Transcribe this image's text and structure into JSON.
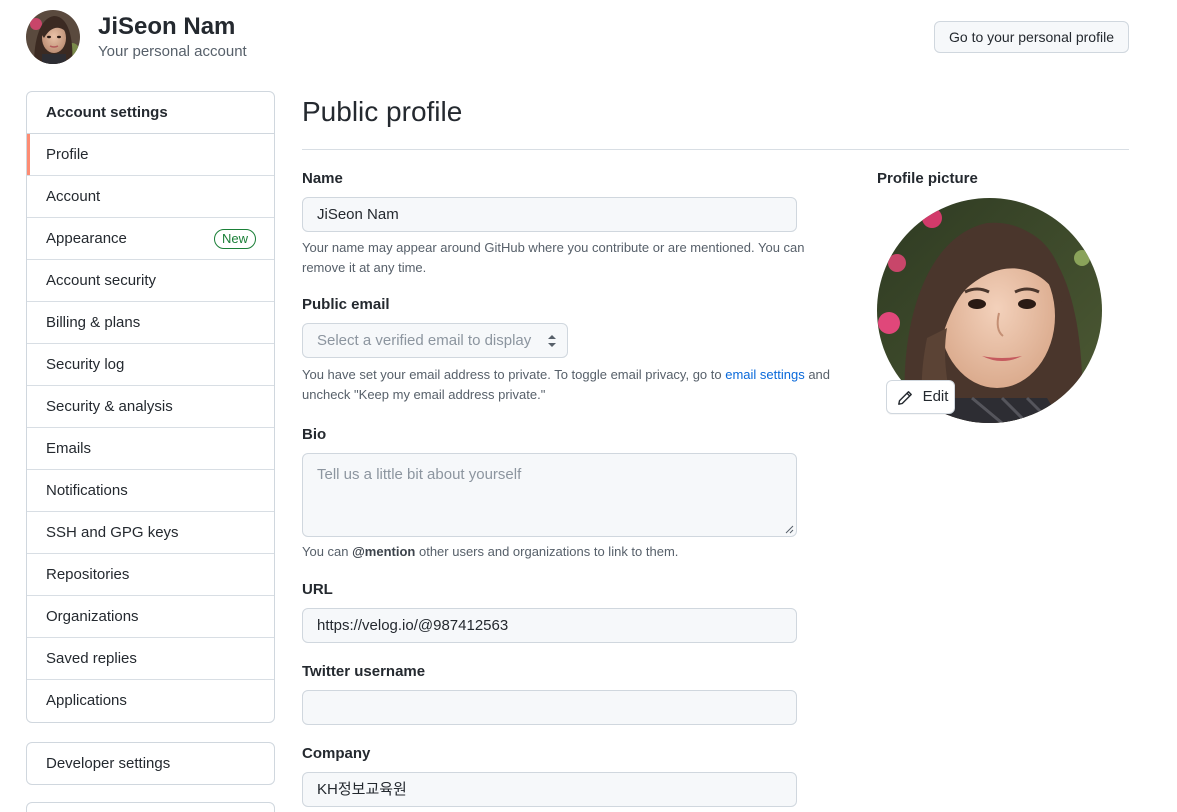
{
  "header": {
    "user_name": "JiSeon Nam",
    "subtitle": "Your personal account",
    "profile_button": "Go to your personal profile"
  },
  "sidebar": {
    "heading": "Account settings",
    "items": [
      {
        "label": "Profile",
        "selected": true
      },
      {
        "label": "Account"
      },
      {
        "label": "Appearance",
        "badge": "New"
      },
      {
        "label": "Account security"
      },
      {
        "label": "Billing & plans"
      },
      {
        "label": "Security log"
      },
      {
        "label": "Security & analysis"
      },
      {
        "label": "Emails"
      },
      {
        "label": "Notifications"
      },
      {
        "label": "SSH and GPG keys"
      },
      {
        "label": "Repositories"
      },
      {
        "label": "Organizations"
      },
      {
        "label": "Saved replies"
      },
      {
        "label": "Applications"
      }
    ],
    "developer_settings": "Developer settings"
  },
  "main": {
    "title": "Public profile",
    "name": {
      "label": "Name",
      "value": "JiSeon Nam",
      "note": "Your name may appear around GitHub where you contribute or are mentioned. You can remove it at any time."
    },
    "public_email": {
      "label": "Public email",
      "placeholder": "Select a verified email to display",
      "note_before": "You have set your email address to private. To toggle email privacy, go to ",
      "note_link": "email settings",
      "note_after": " and uncheck \"Keep my email address private.\""
    },
    "bio": {
      "label": "Bio",
      "placeholder": "Tell us a little bit about yourself",
      "note_before": "You can ",
      "note_mention": "@mention",
      "note_after": " other users and organizations to link to them."
    },
    "url": {
      "label": "URL",
      "value": "https://velog.io/@987412563"
    },
    "twitter": {
      "label": "Twitter username",
      "value": ""
    },
    "company": {
      "label": "Company",
      "value": "KH정보교육원"
    }
  },
  "profile_picture": {
    "label": "Profile picture",
    "edit_label": "Edit"
  },
  "colors": {
    "accent_selected": "#fd8c73",
    "link": "#0969da",
    "badge_green": "#1a7f37"
  },
  "icons": {
    "edit": "pencil-icon",
    "select_caret": "select-caret-icon"
  }
}
